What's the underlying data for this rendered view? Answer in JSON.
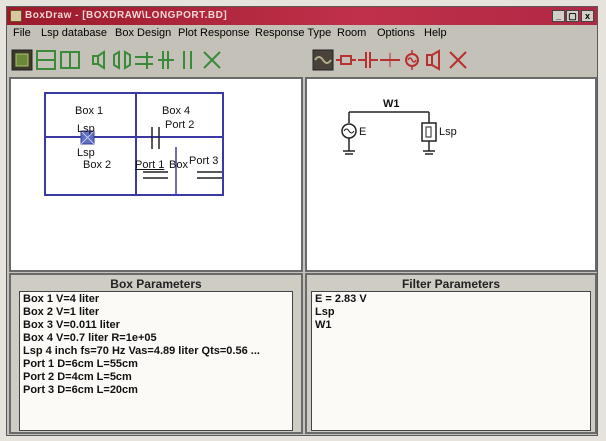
{
  "window": {
    "title": "BoxDraw - [BOXDRAW\\LONGPORT.BD]",
    "buttons": [
      "_",
      "▢",
      "x"
    ]
  },
  "menu": [
    "File",
    "Lsp database",
    "Box Design",
    "Plot Response",
    "Response Type",
    "Room",
    "Options",
    "Help"
  ],
  "box_diagram": {
    "box1": "Box 1",
    "box4": "Box 4",
    "port2": "Port 2",
    "lsp_top": "Lsp",
    "lsp_bottom": "Lsp",
    "box2": "Box 2",
    "port1": "Port 1",
    "box3": "Box",
    "port3": "Port 3"
  },
  "circuit": {
    "w1": "W1",
    "source": "E",
    "lsp": "Lsp"
  },
  "box_parameters": {
    "title": "Box Parameters",
    "rows": [
      "Box 1  V=4 liter",
      "Box 2  V=1 liter",
      "Box 3  V=0.011 liter",
      "Box 4  V=0.7 liter R=1e+05",
      "Lsp  4 inch fs=70 Hz  Vas=4.89 liter  Qts=0.56 ...",
      "Port 1   D=6cm L=55cm",
      "Port 2   D=4cm L=5cm",
      "Port 3   D=6cm L=20cm"
    ]
  },
  "filter_parameters": {
    "title": "Filter Parameters",
    "rows": [
      "E = 2.83 V",
      "Lsp",
      "W1"
    ]
  },
  "colors": {
    "titlebar": "#b02844",
    "box_outline": "#3a3aa0",
    "lsp_marker": "#6070c0",
    "toolbar_green": "#3a8a3a",
    "toolbar_red": "#b83030"
  }
}
